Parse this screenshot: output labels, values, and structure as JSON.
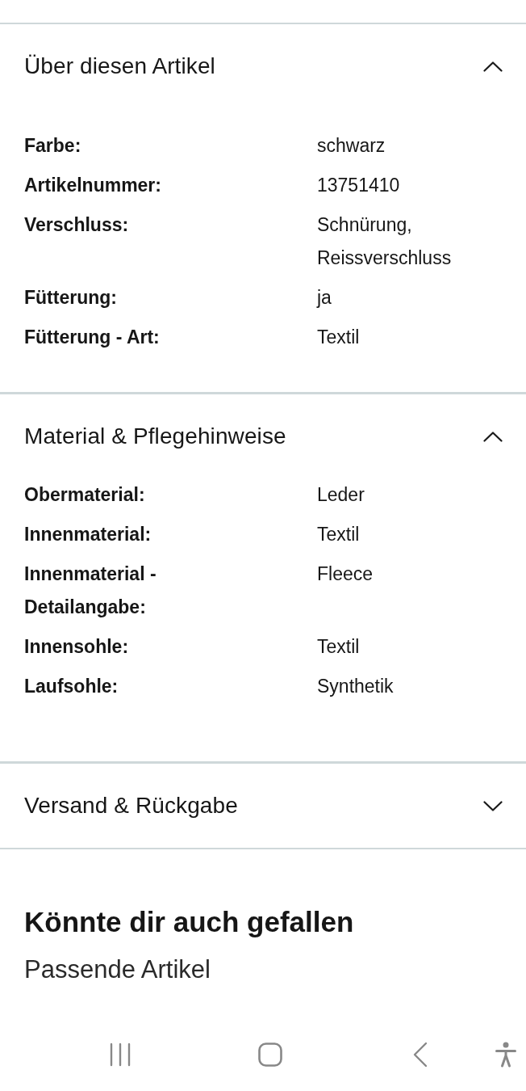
{
  "sections": [
    {
      "title": "Über diesen Artikel",
      "expanded": true,
      "rows": [
        {
          "label": "Farbe:",
          "value": "schwarz"
        },
        {
          "label": "Artikelnummer:",
          "value": "13751410"
        },
        {
          "label": "Verschluss:",
          "value": "Schnürung, Reissverschluss"
        },
        {
          "label": "Fütterung:",
          "value": "ja"
        },
        {
          "label": "Fütterung - Art:",
          "value": "Textil"
        }
      ]
    },
    {
      "title": "Material & Pflegehinweise",
      "expanded": true,
      "rows": [
        {
          "label": "Obermaterial:",
          "value": "Leder"
        },
        {
          "label": "Innenmaterial:",
          "value": "Textil"
        },
        {
          "label": "Innenmaterial - Detailangabe:",
          "value": "Fleece"
        },
        {
          "label": "Innensohle:",
          "value": "Textil"
        },
        {
          "label": "Laufsohle:",
          "value": "Synthetik"
        }
      ]
    },
    {
      "title": "Versand & Rückgabe",
      "expanded": false
    }
  ],
  "recommendations": {
    "title": "Könnte dir auch gefallen",
    "subtitle": "Passende Artikel"
  }
}
